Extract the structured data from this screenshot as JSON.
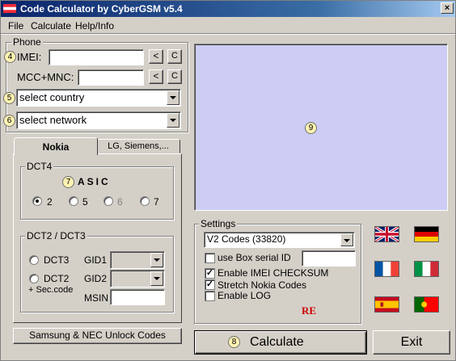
{
  "window": {
    "title": "Code Calculator by CyberGSM v5.4",
    "close": "×"
  },
  "menu": [
    "File",
    "Calculate",
    "Help/Info"
  ],
  "phone": {
    "group_label": "Phone",
    "imei_label": "IMEI:",
    "imei_value": "",
    "mcc_label": "MCC+MNC:",
    "mcc_value": "",
    "back_btn": "<",
    "clear_btn": "C",
    "country_select": "select country",
    "network_select": "select network"
  },
  "badges": {
    "b4": "4",
    "b5": "5",
    "b6": "6",
    "b7": "7",
    "b8": "8",
    "b9": "9"
  },
  "tabs": {
    "nokia": "Nokia",
    "other": "LG, Siemens,..."
  },
  "dct4": {
    "label": "DCT4",
    "asic": "ASIC",
    "options": [
      "2",
      "5",
      "6",
      "7"
    ],
    "selected": "2"
  },
  "dct2": {
    "label": "DCT2 / DCT3",
    "dct3": "DCT3",
    "dct2": "DCT2",
    "sec": "+ Sec.code",
    "gid1": "GID1",
    "gid2": "GID2",
    "msin": "MSIN"
  },
  "samsung_btn": "Samsung & NEC Unlock Codes",
  "settings": {
    "label": "Settings",
    "codes_select": "V2 Codes (33820)",
    "box_serial": "use Box serial ID",
    "box_serial_checked": false,
    "imei_checksum": "Enable IMEI CHECKSUM",
    "imei_checksum_checked": true,
    "stretch": "Stretch Nokia Codes",
    "stretch_checked": true,
    "log": "Enable LOG",
    "log_checked": false,
    "re": "RE"
  },
  "calculate_btn": "Calculate",
  "exit_btn": "Exit",
  "flags": [
    "uk-flag",
    "germany-flag",
    "france-flag",
    "italy-flag",
    "spain-flag",
    "portugal-flag"
  ],
  "colors": {
    "display": "#ccccf5",
    "titlebar": "#0a246a",
    "re": "#cc0000"
  }
}
